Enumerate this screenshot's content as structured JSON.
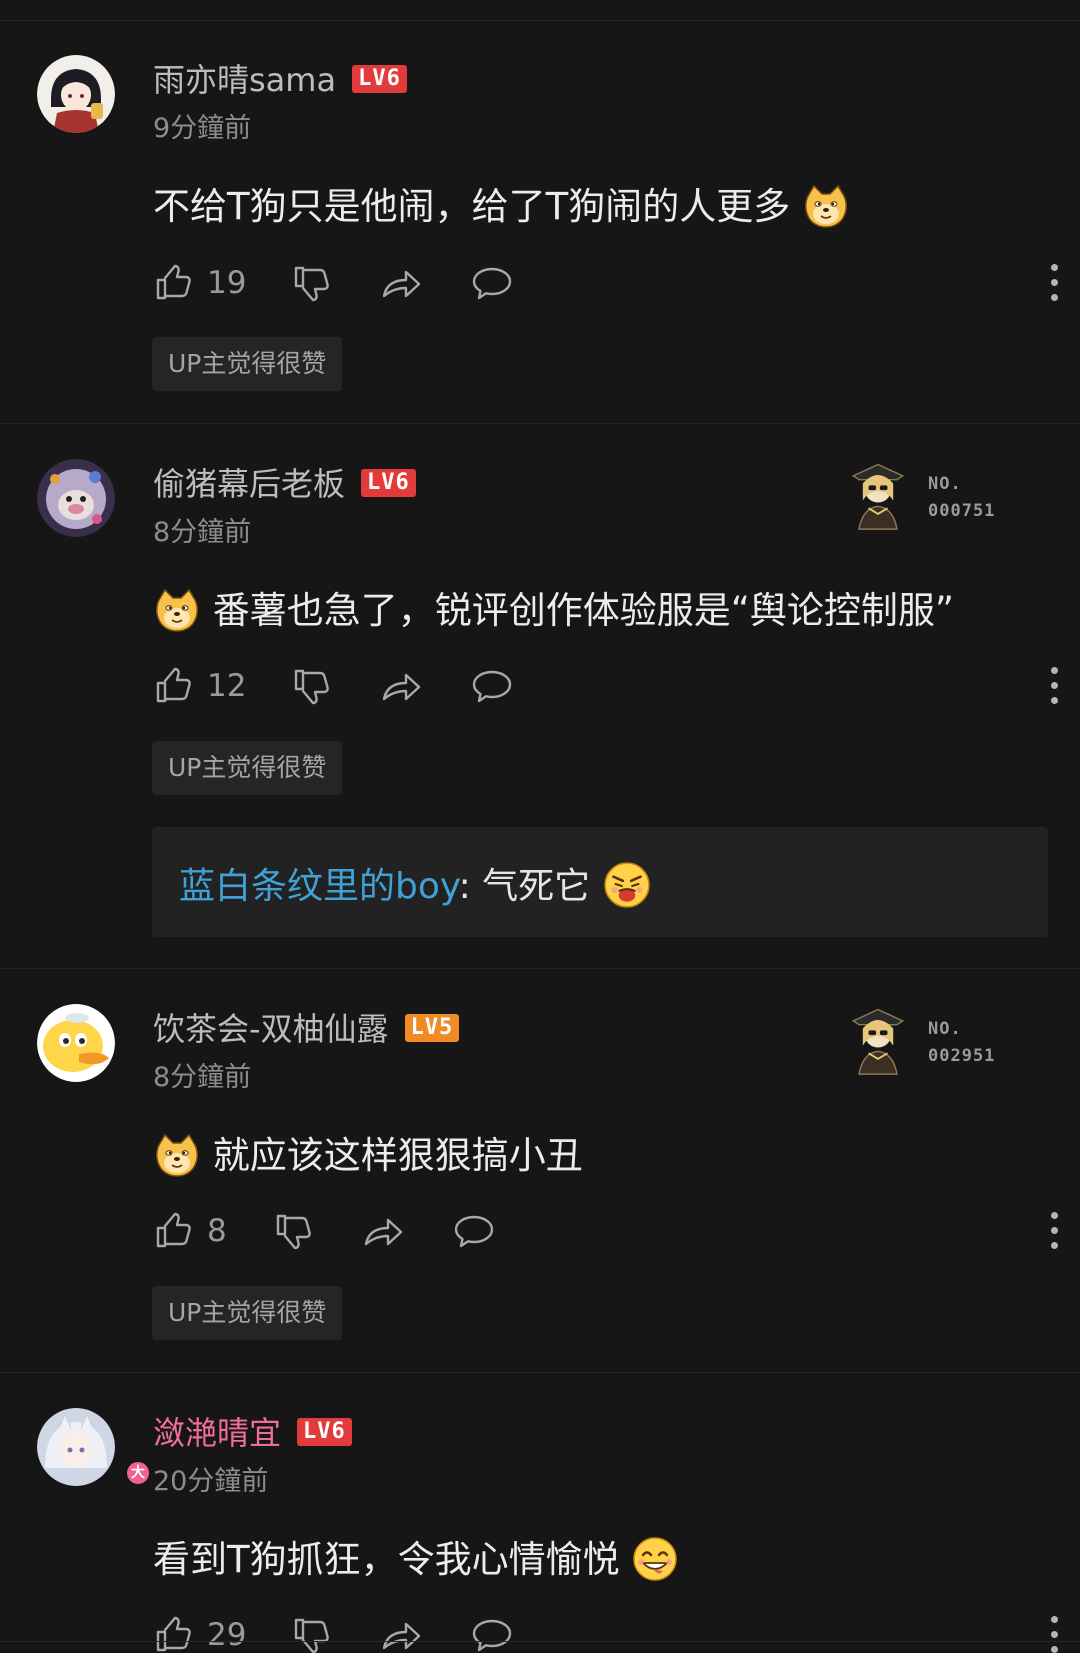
{
  "comments": [
    {
      "username": "雨亦晴sama",
      "level": "LV6",
      "timestamp": "9分鐘前",
      "content": "不给T狗只是他闹，给了T狗闹的人更多",
      "likes": "19",
      "up_badge": "UP主觉得很赞"
    },
    {
      "username": "偷猪幕后老板",
      "level": "LV6",
      "timestamp": "8分鐘前",
      "content": "番薯也急了，锐评创作体验服是“舆论控制服”",
      "likes": "12",
      "up_badge": "UP主觉得很赞",
      "fan_badge": {
        "line1": "NO.",
        "line2": "000751"
      },
      "reply": {
        "user": "蓝白条纹里的boy",
        "separator": ": ",
        "text": "气死它"
      }
    },
    {
      "username": "饮茶会-双柚仙露",
      "level": "LV5",
      "timestamp": "8分鐘前",
      "content": "就应该这样狠狠搞小丑",
      "likes": "8",
      "up_badge": "UP主觉得很赞",
      "fan_badge": {
        "line1": "NO.",
        "line2": "002951"
      }
    },
    {
      "username": "潋滟晴宜",
      "level": "LV6",
      "timestamp": "20分鐘前",
      "content": "看到T狗抓狂，令我心情愉悦",
      "likes": "29",
      "vip_mark": "大"
    }
  ],
  "colors": {
    "background": "#161616",
    "level6": "#e23b3b",
    "level5": "#f08a24",
    "vip_username": "#ef6f96",
    "reply_user": "#3fa1d6"
  }
}
